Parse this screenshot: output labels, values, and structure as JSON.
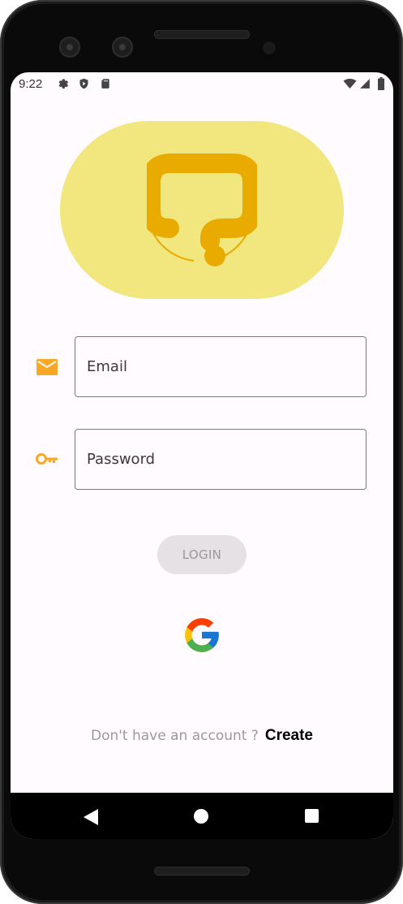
{
  "status_bar": {
    "time": "9:22",
    "left_icons": [
      "gear-icon",
      "shield-icon",
      "sd-card-icon"
    ],
    "right_icons": [
      "wifi-icon",
      "signal-icon",
      "battery-icon"
    ]
  },
  "logo": {
    "background_color": "#f2e67e",
    "mark_color": "#eaab00"
  },
  "form": {
    "email": {
      "placeholder": "Email",
      "value": "",
      "icon": "mail-icon"
    },
    "password": {
      "placeholder": "Password",
      "value": "",
      "icon": "key-icon"
    },
    "login_label": "LOGIN"
  },
  "social": {
    "google": "google-icon"
  },
  "signup": {
    "prompt": "Don't have an account ?",
    "link": "Create"
  },
  "nav_bar": {
    "back": "back-icon",
    "home": "home-icon",
    "recents": "recents-icon"
  },
  "colors": {
    "accent": "#f9a825",
    "screen_bg": "#fffbfe"
  }
}
